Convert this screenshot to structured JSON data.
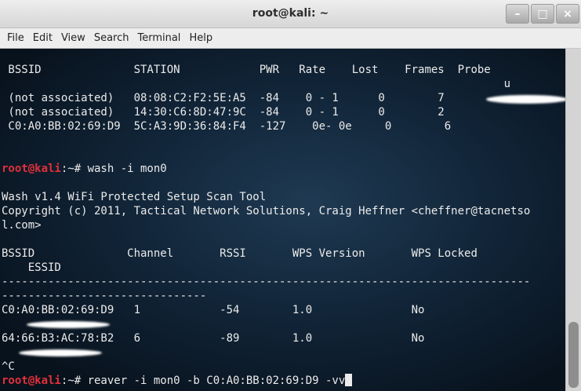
{
  "window": {
    "title": "root@kali: ~",
    "controls": [
      "–",
      "□",
      "×"
    ]
  },
  "menu": [
    "File",
    "Edit",
    "View",
    "Search",
    "Terminal",
    "Help"
  ],
  "terminal_lines": [
    {
      "text": " BSSID              STATION            PWR   Rate    Lost    Frames  Probe"
    },
    {
      "text": "                                                                            u"
    },
    {
      "text": " (not associated)   08:08:C2:F2:5E:A5  -84    0 - 1      0        7"
    },
    {
      "text": " (not associated)   14:30:C6:8D:47:9C  -84    0 - 1      0        2"
    },
    {
      "text": " C0:A0:BB:02:69:D9  5C:A3:9D:36:84:F4  -127    0e- 0e     0        6"
    },
    {
      "text": ""
    },
    {
      "text": ""
    },
    {
      "prompt": "root@kali",
      "text": ":~# wash -i mon0"
    },
    {
      "text": ""
    },
    {
      "text": "Wash v1.4 WiFi Protected Setup Scan Tool"
    },
    {
      "text": "Copyright (c) 2011, Tactical Network Solutions, Craig Heffner <cheffner@tacnetso"
    },
    {
      "text": "l.com>"
    },
    {
      "text": ""
    },
    {
      "text": "BSSID              Channel       RSSI       WPS Version       WPS Locked"
    },
    {
      "text": "    ESSID"
    },
    {
      "text": "--------------------------------------------------------------------------------"
    },
    {
      "text": "-------------------------------"
    },
    {
      "text": "C0:A0:BB:02:69:D9   1            -54        1.0               No"
    },
    {
      "text": ""
    },
    {
      "text": "64:66:B3:AC:78:B2   6            -89        1.0               No"
    },
    {
      "text": ""
    },
    {
      "text": "^C"
    },
    {
      "prompt": "root@kali",
      "text": ":~# reaver -i mon0 -b C0:A0:BB:02:69:D9 -vv",
      "cursor": true
    }
  ],
  "scrollbar": {
    "position_fraction": 0.95
  }
}
